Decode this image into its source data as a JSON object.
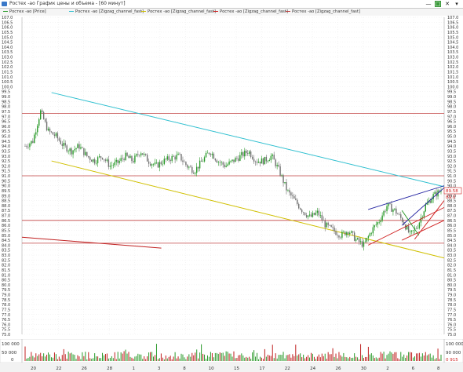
{
  "window": {
    "title": "Ростех -ао График цены и объема - [60 минут]",
    "minimize_glyph": "—",
    "maximize_glyph": "□",
    "close_glyph": "✕"
  },
  "legend": [
    {
      "label": "Ростех -ао [Price]",
      "color": "#2a9a2a"
    },
    {
      "label": "Ростех -ао [Zigzag_channel_fast]",
      "color": "#30c0d0"
    },
    {
      "label": "Ростех -ао [Zigzag_channel_fast]",
      "color": "#d0c000"
    },
    {
      "label": "Ростех -ао [Zigzag_channel_fast]",
      "color": "#d02020"
    },
    {
      "label": "Ростех -ао [Zigzag_channel_fast]",
      "color": "#c04040"
    }
  ],
  "price_axis": {
    "min": 75.0,
    "max": 107.0,
    "step": 0.5,
    "current_price_label": "89.58",
    "current_price_label2": "89.0"
  },
  "volume_axis": {
    "labels": [
      "100 000",
      "50 000",
      "0"
    ],
    "current_volume_label": "90 000",
    "current_volume_label2": "0 915"
  },
  "dates": [
    "20",
    "22",
    "26",
    "28",
    "1",
    "3",
    "8",
    "10",
    "15",
    "17",
    "22",
    "24",
    "26",
    "30",
    "2",
    "6",
    "8"
  ],
  "chart_data": {
    "type": "candlestick",
    "ylim": [
      75.0,
      107.0
    ],
    "horizontal_levels": [
      97.3,
      91.0,
      86.5,
      84.2
    ],
    "channel_lines": [
      {
        "name": "upper",
        "color": "#30c0d0",
        "x": [
          0.07,
          1.0
        ],
        "y": [
          99.4,
          89.9
        ]
      },
      {
        "name": "lower",
        "color": "#d0c000",
        "x": [
          0.07,
          1.0
        ],
        "y": [
          92.5,
          82.7
        ]
      },
      {
        "name": "red-left",
        "color": "#c02020",
        "x": [
          0.0,
          0.33
        ],
        "y": [
          84.8,
          83.7
        ]
      }
    ],
    "price_path": [
      94.0,
      94.5,
      97.5,
      95.5,
      95.0,
      94.0,
      93.5,
      94.0,
      93.0,
      92.5,
      93.0,
      92.0,
      92.3,
      93.0,
      92.5,
      93.5,
      92.5,
      92.0,
      92.5,
      92.8,
      93.0,
      92.0,
      91.5,
      92.5,
      93.5,
      92.5,
      92.0,
      92.5,
      93.0,
      93.5,
      92.5,
      92.5,
      93.0,
      91.5,
      89.5,
      88.5,
      87.5,
      86.8,
      87.3,
      86.0,
      85.5,
      85.0,
      85.5,
      84.5,
      84.0,
      85.5,
      86.5,
      88.0,
      87.5,
      86.5,
      85.0,
      86.0,
      88.0,
      89.0,
      89.5
    ]
  }
}
